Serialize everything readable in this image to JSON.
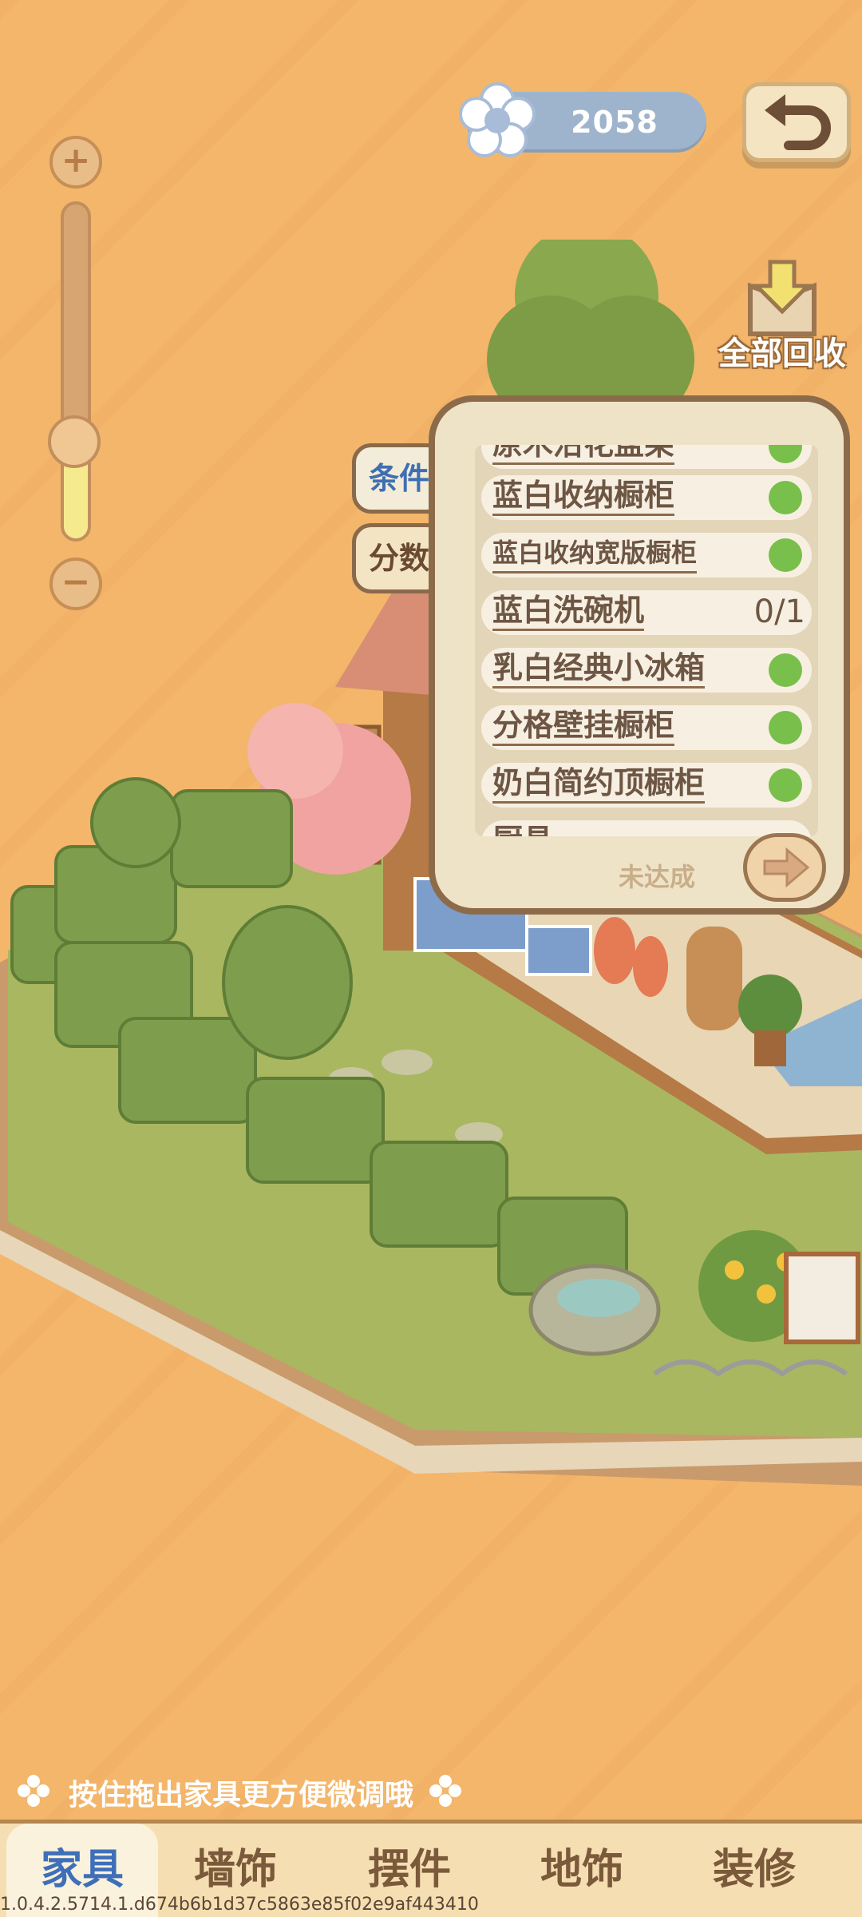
{
  "currency": {
    "amount": "2058",
    "icon": "flower-icon"
  },
  "actions": {
    "recycle_all_label": "全部回收"
  },
  "zoom": {
    "level": 0.25
  },
  "panel": {
    "side_tabs": [
      {
        "label": "条件",
        "active": true
      },
      {
        "label": "分数",
        "active": false
      }
    ],
    "items": [
      {
        "name": "原木沿花盆架",
        "done": true,
        "progress": ""
      },
      {
        "name": "蓝白收纳橱柜",
        "done": true,
        "progress": ""
      },
      {
        "name": "蓝白收纳宽版橱柜",
        "done": true,
        "progress": ""
      },
      {
        "name": "蓝白洗碗机",
        "done": false,
        "progress": "0/1"
      },
      {
        "name": "乳白经典小冰箱",
        "done": true,
        "progress": ""
      },
      {
        "name": "分格壁挂橱柜",
        "done": true,
        "progress": ""
      },
      {
        "name": "奶白简约顶橱柜",
        "done": true,
        "progress": ""
      },
      {
        "name": "厨具",
        "done": false,
        "progress": ""
      }
    ],
    "status": "未达成"
  },
  "hint": "按住拖出家具更方便微调哦",
  "tabs": [
    {
      "label": "家具",
      "active": true
    },
    {
      "label": "墙饰",
      "active": false
    },
    {
      "label": "摆件",
      "active": false
    },
    {
      "label": "地饰",
      "active": false
    },
    {
      "label": "装修",
      "active": false
    }
  ],
  "version": "1.0.4.2.5714.1.d674b6b1d37c5863e85f02e9af443410",
  "colors": {
    "background": "#f3b66b",
    "accent_blue": "#3e6fb8",
    "check_green": "#79bf4b"
  }
}
